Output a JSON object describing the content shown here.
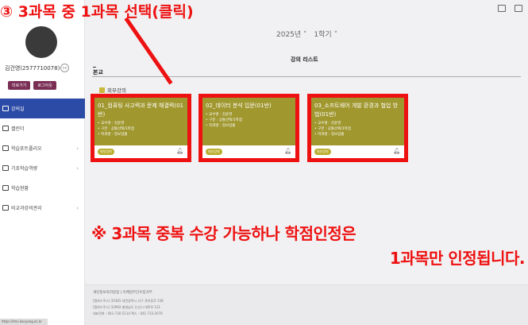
{
  "annotation": {
    "step_title": "③ 3과목 중 1과목 선택(클릭)",
    "note_line1": "※ 3과목 중복 수강 가능하나 학점인정은",
    "note_line2": "1과목만 인정됩니다.",
    "color": "#ee1111"
  },
  "sidebar": {
    "user_name": "김건영(2577710078)",
    "buttons": [
      "미로가기",
      "로그아웃"
    ],
    "items": [
      {
        "label": "강의실",
        "active": true,
        "chevron": false
      },
      {
        "label": "캘린더",
        "active": false,
        "chevron": false
      },
      {
        "label": "학습포트폴리오",
        "active": false,
        "chevron": true
      },
      {
        "label": "기초학습역량",
        "active": false,
        "chevron": true
      },
      {
        "label": "학습현황",
        "active": false,
        "chevron": false
      },
      {
        "label": "비교과강의관리",
        "active": false,
        "chevron": true
      }
    ],
    "active_color": "#2c4ba6"
  },
  "header": {
    "year": "2025년 ˅",
    "term": "1학기 ˅"
  },
  "content": {
    "list_title": "강의 리스트",
    "section": "본교",
    "category": "외부강의",
    "cards": [
      {
        "title": "01_컴퓨팅 사고력과 문제 해결력(01반)",
        "professor": "• 교수명 : 김윤영",
        "type": "• 구분 : 공통선택/1학점",
        "dept": "• 학과명 : 정보입출",
        "tag": "외부강의"
      },
      {
        "title": "02_데이터 분석 입문(01반)",
        "professor": "• 교수명 : 김윤영",
        "type": "• 구분 : 공통선택/1학점",
        "dept": "• 학과명 : 정보입출",
        "tag": "외부강의"
      },
      {
        "title": "03_소프트웨어 개발 환경과 협업 방법(01반)",
        "professor": "• 교수명 : 김윤영",
        "type": "• 구분 : 공통선택/1학점",
        "dept": "• 학과명 : 정보입출",
        "tag": "외부강의"
      }
    ],
    "card_color": "#a0972f"
  },
  "footer": {
    "links": "개인정보처리방침  |  이메일무단수집거부",
    "lines": [
      "[캠퍼스주소] 35365 대전광역시 서구 관저동로 158",
      "[캠퍼스주소] 32992 충청남도 논산시 대학로 121",
      "대표전화 : 041-730-5114 팩스 : 041-733-2070"
    ]
  },
  "status": "https://lms.konyang.ac.kr"
}
